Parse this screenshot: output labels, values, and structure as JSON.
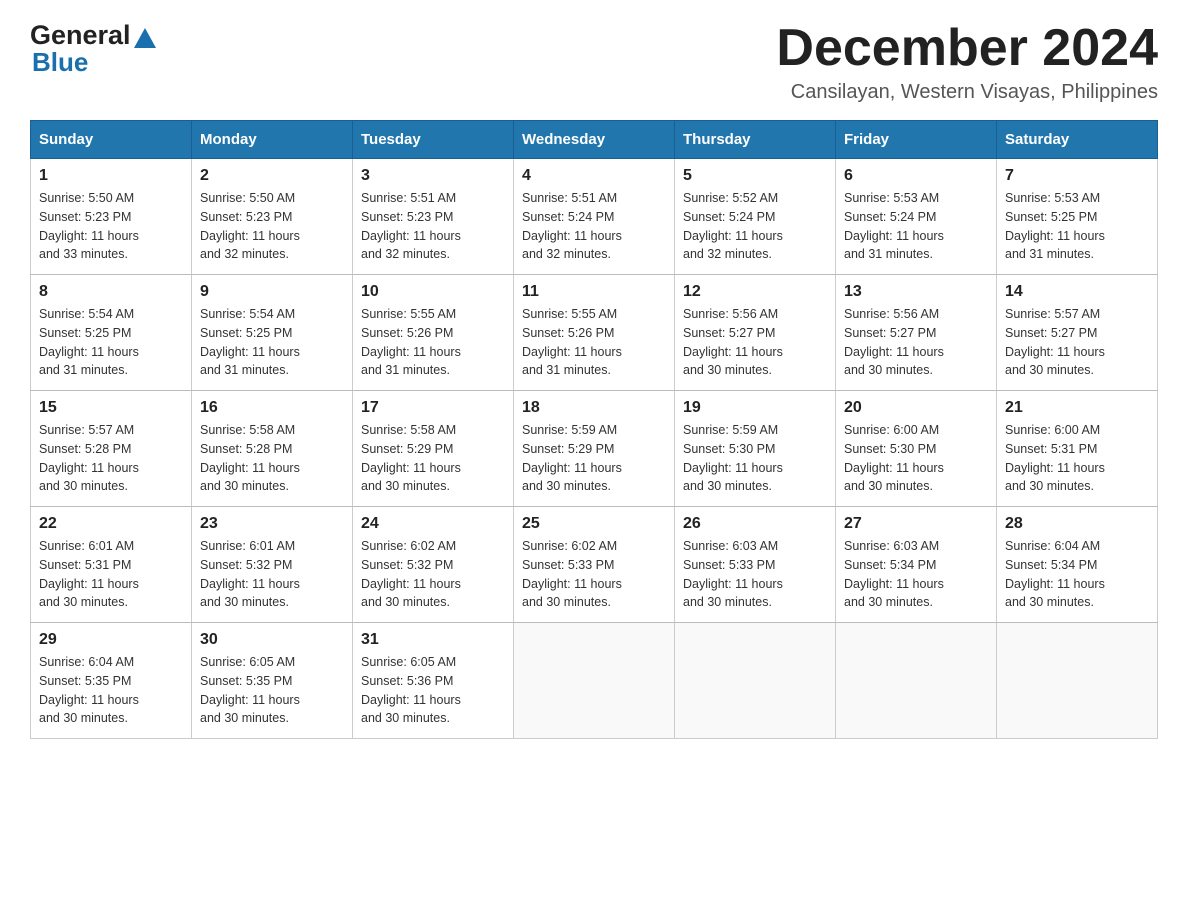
{
  "header": {
    "logo_general": "General",
    "logo_blue": "Blue",
    "month_title": "December 2024",
    "location": "Cansilayan, Western Visayas, Philippines"
  },
  "days_of_week": [
    "Sunday",
    "Monday",
    "Tuesday",
    "Wednesday",
    "Thursday",
    "Friday",
    "Saturday"
  ],
  "weeks": [
    [
      {
        "day": "1",
        "sunrise": "5:50 AM",
        "sunset": "5:23 PM",
        "daylight": "11 hours and 33 minutes."
      },
      {
        "day": "2",
        "sunrise": "5:50 AM",
        "sunset": "5:23 PM",
        "daylight": "11 hours and 32 minutes."
      },
      {
        "day": "3",
        "sunrise": "5:51 AM",
        "sunset": "5:23 PM",
        "daylight": "11 hours and 32 minutes."
      },
      {
        "day": "4",
        "sunrise": "5:51 AM",
        "sunset": "5:24 PM",
        "daylight": "11 hours and 32 minutes."
      },
      {
        "day": "5",
        "sunrise": "5:52 AM",
        "sunset": "5:24 PM",
        "daylight": "11 hours and 32 minutes."
      },
      {
        "day": "6",
        "sunrise": "5:53 AM",
        "sunset": "5:24 PM",
        "daylight": "11 hours and 31 minutes."
      },
      {
        "day": "7",
        "sunrise": "5:53 AM",
        "sunset": "5:25 PM",
        "daylight": "11 hours and 31 minutes."
      }
    ],
    [
      {
        "day": "8",
        "sunrise": "5:54 AM",
        "sunset": "5:25 PM",
        "daylight": "11 hours and 31 minutes."
      },
      {
        "day": "9",
        "sunrise": "5:54 AM",
        "sunset": "5:25 PM",
        "daylight": "11 hours and 31 minutes."
      },
      {
        "day": "10",
        "sunrise": "5:55 AM",
        "sunset": "5:26 PM",
        "daylight": "11 hours and 31 minutes."
      },
      {
        "day": "11",
        "sunrise": "5:55 AM",
        "sunset": "5:26 PM",
        "daylight": "11 hours and 31 minutes."
      },
      {
        "day": "12",
        "sunrise": "5:56 AM",
        "sunset": "5:27 PM",
        "daylight": "11 hours and 30 minutes."
      },
      {
        "day": "13",
        "sunrise": "5:56 AM",
        "sunset": "5:27 PM",
        "daylight": "11 hours and 30 minutes."
      },
      {
        "day": "14",
        "sunrise": "5:57 AM",
        "sunset": "5:27 PM",
        "daylight": "11 hours and 30 minutes."
      }
    ],
    [
      {
        "day": "15",
        "sunrise": "5:57 AM",
        "sunset": "5:28 PM",
        "daylight": "11 hours and 30 minutes."
      },
      {
        "day": "16",
        "sunrise": "5:58 AM",
        "sunset": "5:28 PM",
        "daylight": "11 hours and 30 minutes."
      },
      {
        "day": "17",
        "sunrise": "5:58 AM",
        "sunset": "5:29 PM",
        "daylight": "11 hours and 30 minutes."
      },
      {
        "day": "18",
        "sunrise": "5:59 AM",
        "sunset": "5:29 PM",
        "daylight": "11 hours and 30 minutes."
      },
      {
        "day": "19",
        "sunrise": "5:59 AM",
        "sunset": "5:30 PM",
        "daylight": "11 hours and 30 minutes."
      },
      {
        "day": "20",
        "sunrise": "6:00 AM",
        "sunset": "5:30 PM",
        "daylight": "11 hours and 30 minutes."
      },
      {
        "day": "21",
        "sunrise": "6:00 AM",
        "sunset": "5:31 PM",
        "daylight": "11 hours and 30 minutes."
      }
    ],
    [
      {
        "day": "22",
        "sunrise": "6:01 AM",
        "sunset": "5:31 PM",
        "daylight": "11 hours and 30 minutes."
      },
      {
        "day": "23",
        "sunrise": "6:01 AM",
        "sunset": "5:32 PM",
        "daylight": "11 hours and 30 minutes."
      },
      {
        "day": "24",
        "sunrise": "6:02 AM",
        "sunset": "5:32 PM",
        "daylight": "11 hours and 30 minutes."
      },
      {
        "day": "25",
        "sunrise": "6:02 AM",
        "sunset": "5:33 PM",
        "daylight": "11 hours and 30 minutes."
      },
      {
        "day": "26",
        "sunrise": "6:03 AM",
        "sunset": "5:33 PM",
        "daylight": "11 hours and 30 minutes."
      },
      {
        "day": "27",
        "sunrise": "6:03 AM",
        "sunset": "5:34 PM",
        "daylight": "11 hours and 30 minutes."
      },
      {
        "day": "28",
        "sunrise": "6:04 AM",
        "sunset": "5:34 PM",
        "daylight": "11 hours and 30 minutes."
      }
    ],
    [
      {
        "day": "29",
        "sunrise": "6:04 AM",
        "sunset": "5:35 PM",
        "daylight": "11 hours and 30 minutes."
      },
      {
        "day": "30",
        "sunrise": "6:05 AM",
        "sunset": "5:35 PM",
        "daylight": "11 hours and 30 minutes."
      },
      {
        "day": "31",
        "sunrise": "6:05 AM",
        "sunset": "5:36 PM",
        "daylight": "11 hours and 30 minutes."
      },
      null,
      null,
      null,
      null
    ]
  ],
  "labels": {
    "sunrise": "Sunrise:",
    "sunset": "Sunset:",
    "daylight": "Daylight:"
  }
}
